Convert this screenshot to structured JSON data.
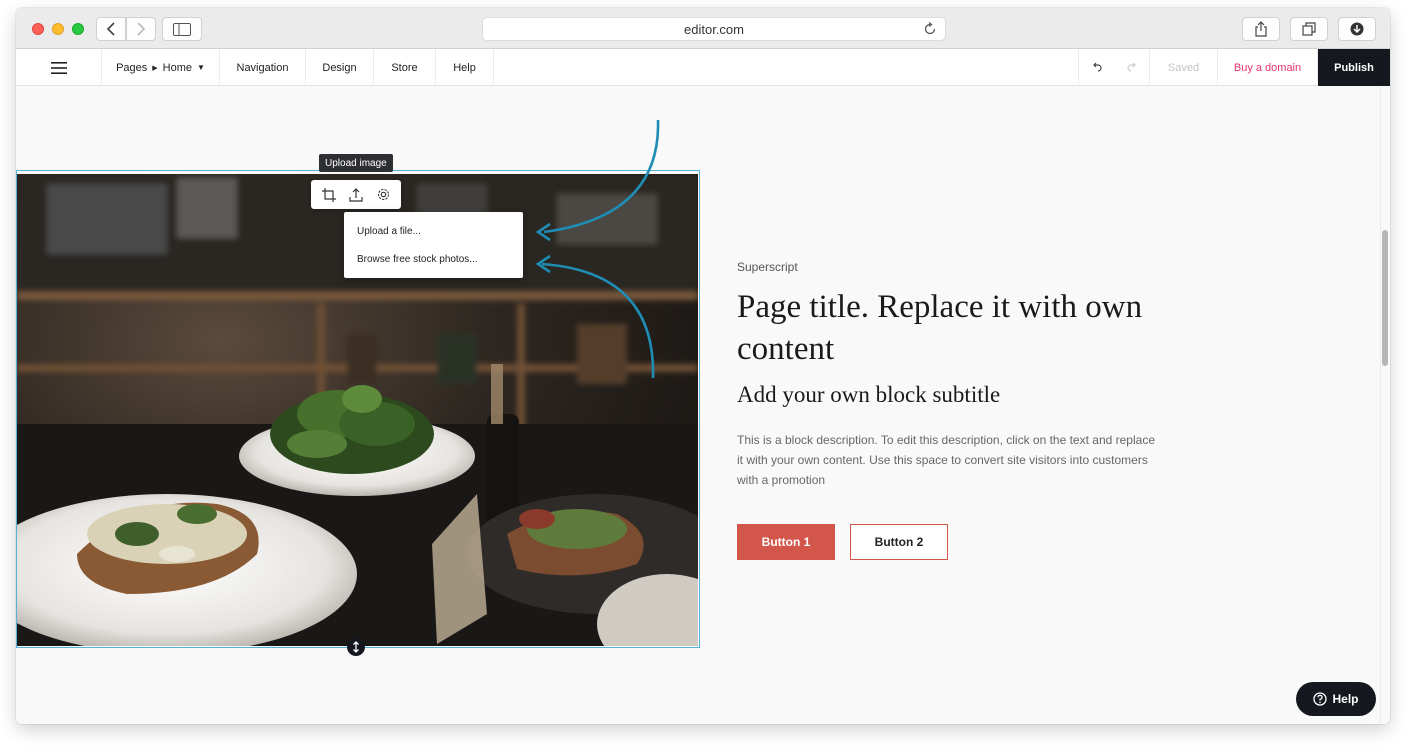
{
  "browser": {
    "url": "editor.com"
  },
  "toolbar": {
    "pages_label": "Pages",
    "current_page": "Home",
    "navigation": "Navigation",
    "design": "Design",
    "store": "Store",
    "help": "Help",
    "saved": "Saved",
    "buy_domain": "Buy a domain",
    "publish": "Publish"
  },
  "image_editor": {
    "tooltip": "Upload image",
    "tools": [
      "crop-icon",
      "upload-icon",
      "settings-icon"
    ],
    "dropdown": {
      "items": [
        "Upload a file...",
        "Browse free stock photos..."
      ]
    }
  },
  "content": {
    "superscript": "Superscript",
    "title": "Page title. Replace it with own content",
    "subtitle": "Add your own block subtitle",
    "description": "This is a block description. To edit this description, click on the text and replace it with your own content. Use this space to convert site visitors into customers with a promotion",
    "button1": "Button 1",
    "button2": "Button 2"
  },
  "help_button": {
    "label": "Help"
  },
  "colors": {
    "accent_red": "#d2574a",
    "domain_pink": "#e2336b",
    "publish_dark": "#15191f",
    "selection_blue": "#55b1d8",
    "annotation_arrow": "#1f8db3"
  }
}
